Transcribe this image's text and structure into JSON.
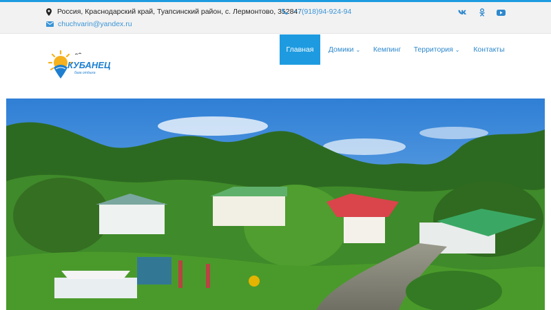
{
  "topbar": {
    "address": "Россия, Краснодарский край, Туапсинский район, с. Лермонтово, 352847",
    "phone": "+7(918)94-924-94",
    "email": "chuchvarin@yandex.ru",
    "social": [
      {
        "name": "vk",
        "glyph": "вк"
      },
      {
        "name": "odnoklassniki",
        "glyph": "ок"
      },
      {
        "name": "youtube",
        "glyph": "▶"
      }
    ]
  },
  "logo": {
    "title": "КУБАНЕЦ",
    "subtitle": "база отдыха"
  },
  "nav": {
    "items": [
      {
        "label": "Главная",
        "active": true
      },
      {
        "label": "Домики",
        "dropdown": true
      },
      {
        "label": "Кемпинг"
      },
      {
        "label": "Территория",
        "dropdown": true
      },
      {
        "label": "Контакты"
      }
    ]
  },
  "hero": {
    "alt": "Территория базы отдыха"
  },
  "colors": {
    "accent": "#1e9be0",
    "link": "#2e88cc",
    "topbar_bg": "#f2f2f2"
  }
}
